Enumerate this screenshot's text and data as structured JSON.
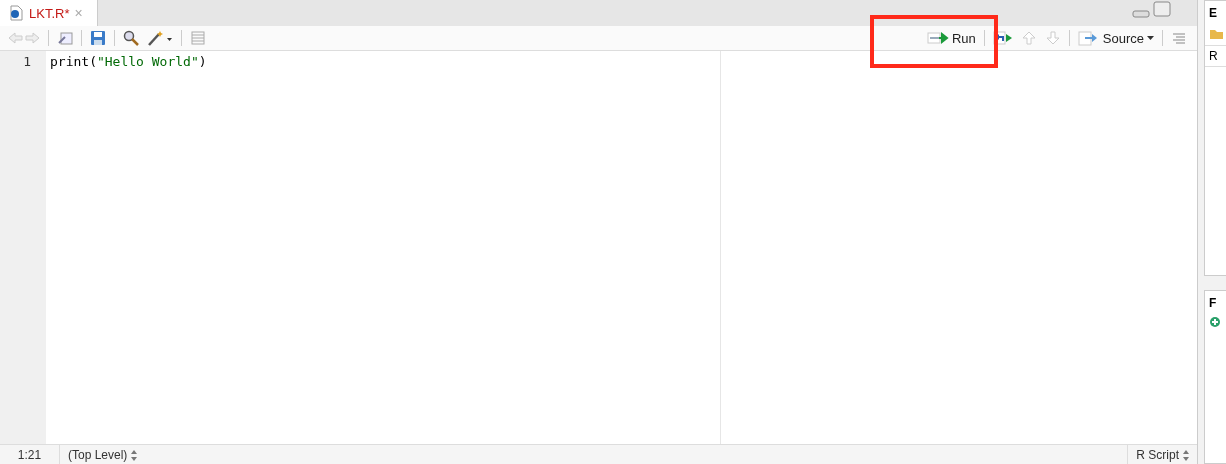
{
  "tab": {
    "title": "LKT.R*",
    "close": "×",
    "modified": true
  },
  "toolbar": {
    "run": "Run",
    "source": "Source"
  },
  "editor": {
    "lines": [
      {
        "number": "1",
        "tokens": [
          {
            "kind": "plain",
            "text": "print("
          },
          {
            "kind": "string",
            "text": "\"Hello World\""
          },
          {
            "kind": "plain",
            "text": ")"
          }
        ]
      }
    ]
  },
  "status_bar": {
    "position": "1:21",
    "scope": "(Top Level)",
    "file_type": "R Script"
  },
  "right_pane": {
    "top_header": "E",
    "top_row": "R",
    "bottom_header": "F"
  },
  "annotations": [
    {
      "kind": "box"
    }
  ]
}
